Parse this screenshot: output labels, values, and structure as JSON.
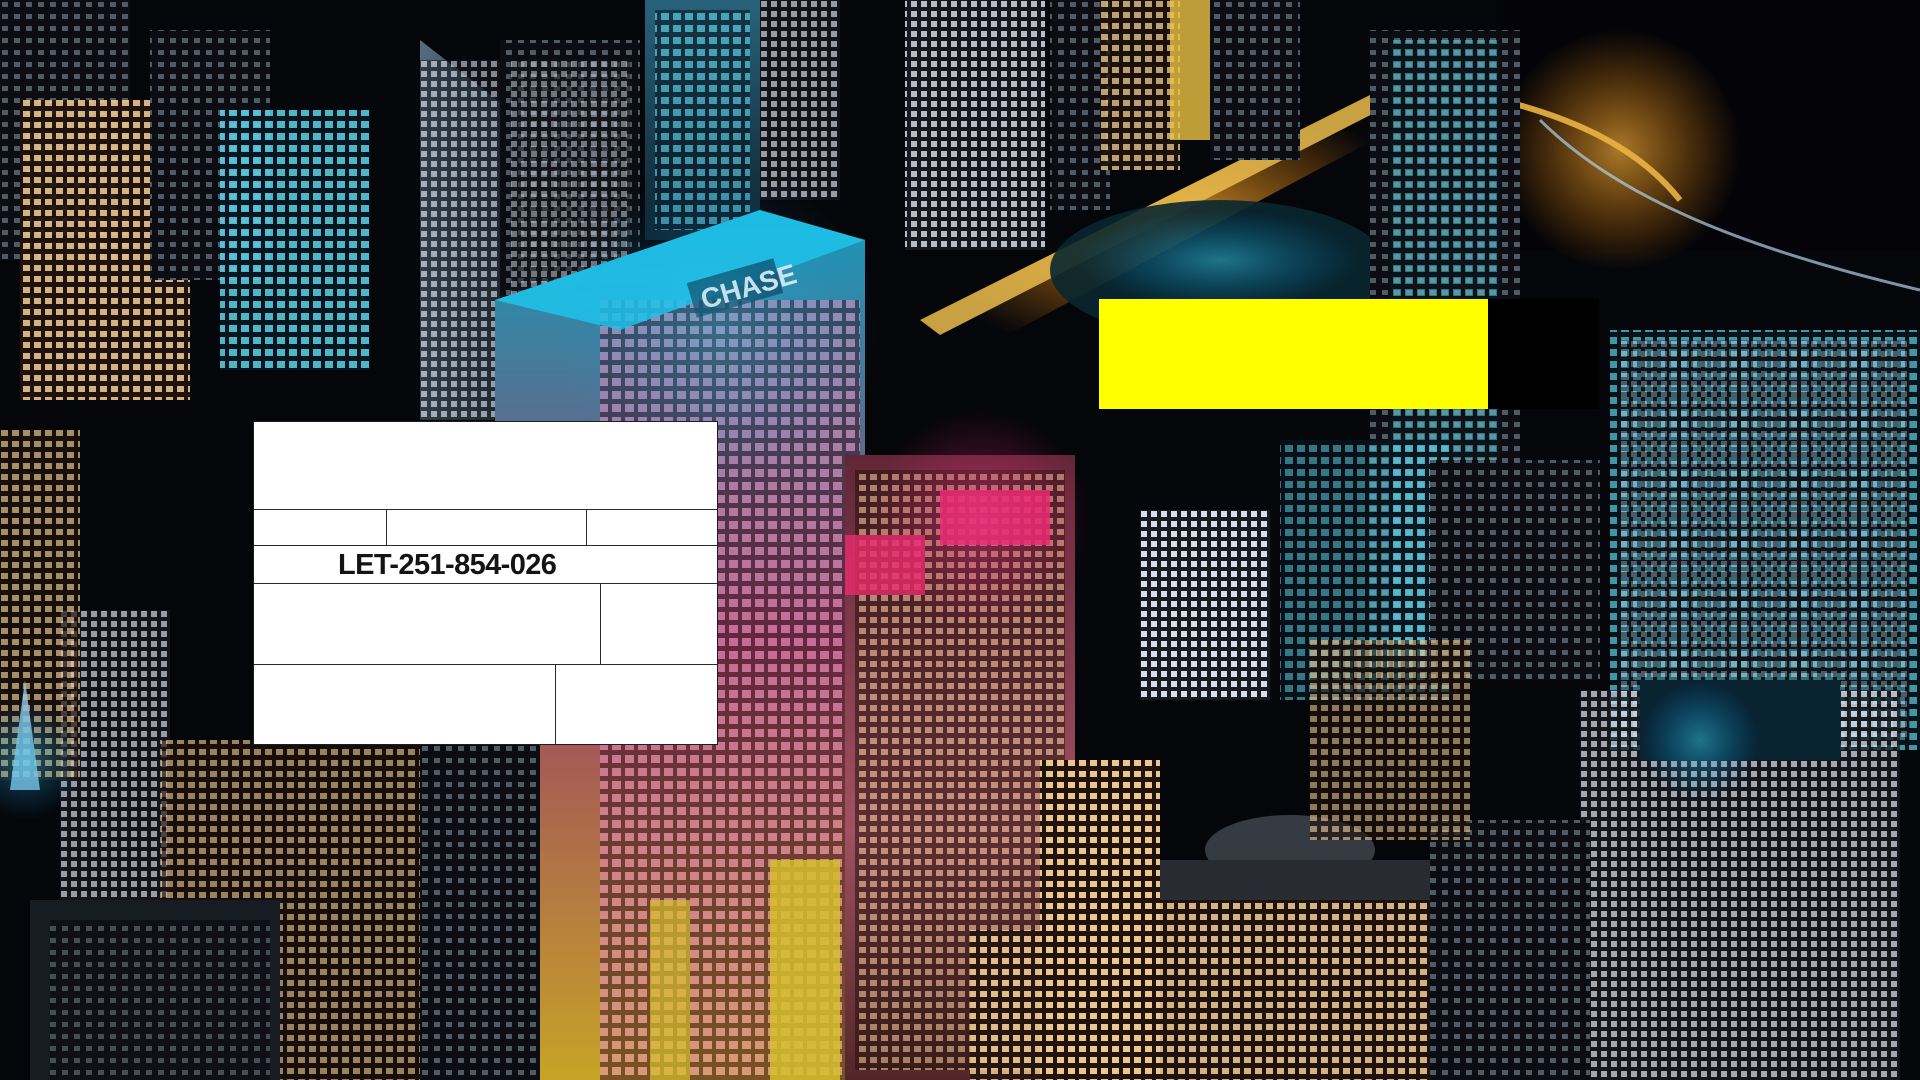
{
  "scene": {
    "background": "aerial-night-city-photo",
    "sign_text": "CHASE"
  },
  "form_card": {
    "id_text": "LET-251-854-026"
  },
  "colors": {
    "card": "#ffffff",
    "card_lines": "#2a2a2a",
    "id_text": "#141414",
    "bar_yellow": "#ffff00",
    "bar_black": "#000000"
  }
}
